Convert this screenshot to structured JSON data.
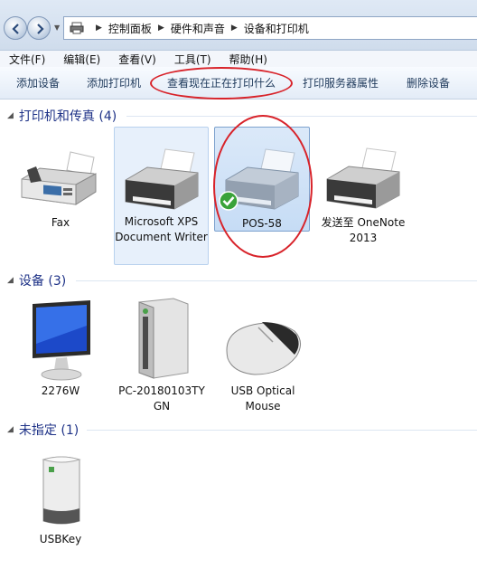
{
  "address": {
    "crumbs": [
      "控制面板",
      "硬件和声音",
      "设备和打印机"
    ]
  },
  "menu": {
    "items": [
      "文件(F)",
      "编辑(E)",
      "查看(V)",
      "工具(T)",
      "帮助(H)"
    ]
  },
  "toolbar": {
    "add_device": "添加设备",
    "add_printer": "添加打印机",
    "see_printing": "查看现在正在打印什么",
    "print_server": "打印服务器属性",
    "remove_device": "删除设备"
  },
  "groups": {
    "printers": {
      "title": "打印机和传真 (4)"
    },
    "devices": {
      "title": "设备 (3)"
    },
    "unspecified": {
      "title": "未指定 (1)"
    }
  },
  "printers": [
    {
      "label": "Fax"
    },
    {
      "label": "Microsoft XPS Document Writer"
    },
    {
      "label": "POS-58"
    },
    {
      "label": "发送至 OneNote 2013"
    }
  ],
  "devices": [
    {
      "label": "2276W"
    },
    {
      "label": "PC-20180103TY GN"
    },
    {
      "label": "USB Optical Mouse"
    }
  ],
  "unspecified": [
    {
      "label": "USBKey"
    }
  ],
  "colors": {
    "accent": "#1e3287",
    "highlight_red": "#d8232a",
    "default_check": "#3aa33a"
  }
}
